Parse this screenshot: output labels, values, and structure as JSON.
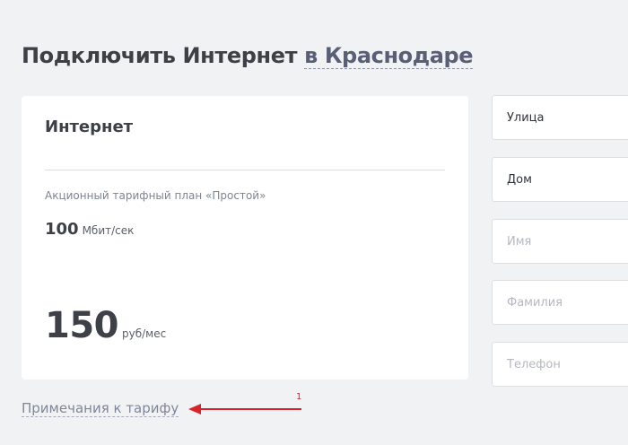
{
  "header": {
    "title_prefix": "Подключить Интернет",
    "city_link": "в Краснодаре"
  },
  "tariff_card": {
    "title": "Интернет",
    "plan_name": "Акционный тарифный план «Простой»",
    "speed_value": "100",
    "speed_unit": "Мбит/сек",
    "price_value": "150",
    "price_unit": "руб/мес"
  },
  "form": {
    "street_placeholder": "Улица",
    "house_placeholder": "Дом",
    "first_name_placeholder": "Имя",
    "last_name_placeholder": "Фамилия",
    "phone_placeholder": "Телефон"
  },
  "footer": {
    "notes_link": "Примечания к тарифу"
  },
  "annotation": {
    "number": "1",
    "color": "#d8232a",
    "icon": "arrow-left-icon"
  }
}
